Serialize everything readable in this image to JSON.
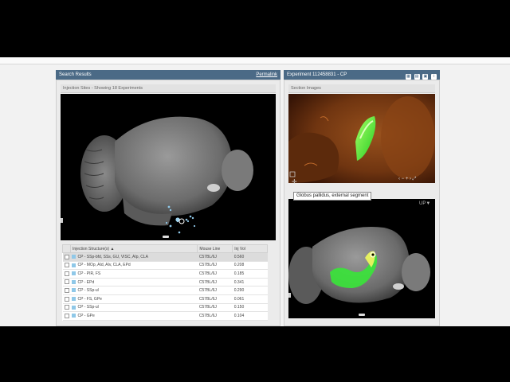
{
  "search": {
    "title": "Search Results",
    "permalink": "Permalink",
    "injection_label": "Injection Sites - Showing 18 Experiments"
  },
  "experiment": {
    "title": "Experiment 112458831 - CP",
    "section_label": "Section Images",
    "tooltip": "Globus pallidus, external segment",
    "orientation": "UP▼",
    "nav": "‹ − + › ⤢"
  },
  "table": {
    "headers": [
      "Injection Structure(s) ▲",
      "Mouse Line",
      "Inj Vol"
    ],
    "rows": [
      {
        "structure": "CP - SSp-bfd, SSs, GU, VISC, AIp, CLA",
        "line": "C57BL/6J",
        "vol": "0.560",
        "selected": true
      },
      {
        "structure": "CP - MOp, AId, AIv, CLA, EPd",
        "line": "C57BL/6J",
        "vol": "0.208",
        "selected": false
      },
      {
        "structure": "CP - PIR, FS",
        "line": "C57BL/6J",
        "vol": "0.185",
        "selected": false
      },
      {
        "structure": "CP - EPd",
        "line": "C57BL/6J",
        "vol": "0.341",
        "selected": false
      },
      {
        "structure": "CP - SSp-ul",
        "line": "C57BL/6J",
        "vol": "0.290",
        "selected": false
      },
      {
        "structure": "CP - FS, GPe",
        "line": "C57BL/6J",
        "vol": "0.061",
        "selected": false
      },
      {
        "structure": "CP - SSp-ul",
        "line": "C57BL/6J",
        "vol": "0.150",
        "selected": false
      },
      {
        "structure": "CP - GPe",
        "line": "C57BL/6J",
        "vol": "0.104",
        "selected": false
      }
    ]
  },
  "colors": {
    "header_bar": "#4b6a86",
    "fiber_green": "#39e639",
    "injection_dot": "#8fc8e8"
  }
}
